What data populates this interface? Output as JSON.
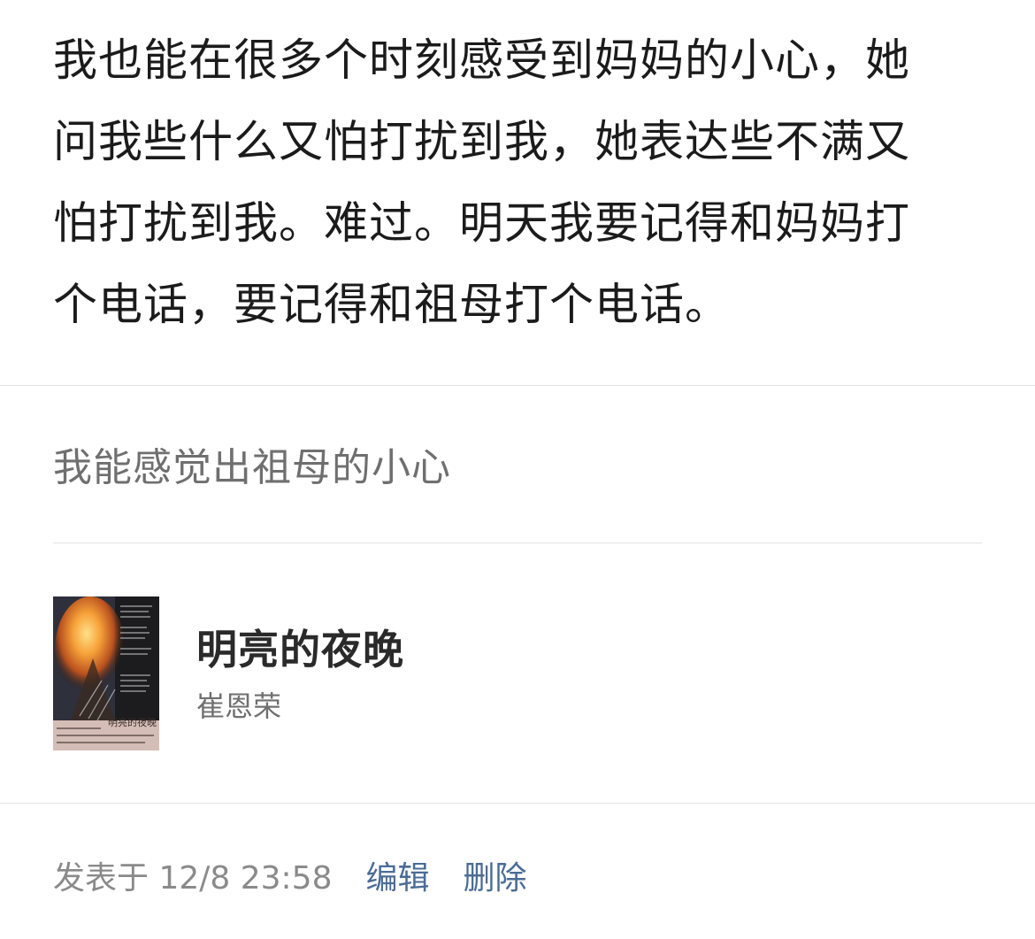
{
  "note": {
    "body": "我也能在很多个时刻感受到妈妈的小心，她\n问我些什么又怕打扰到我，她表达些不满又\n怕打扰到我。难过。明天我要记得和妈妈打\n个电话，要记得和祖母打个电话。"
  },
  "highlight": {
    "text": "我能感觉出祖母的小心"
  },
  "book": {
    "title": "明亮的夜晚",
    "author": "崔恩荣",
    "cover_title": "明亮的夜晚"
  },
  "footer": {
    "timestamp": "发表于 12/8 23:58",
    "edit_label": "编辑",
    "delete_label": "删除"
  },
  "colors": {
    "link": "#4a6c95",
    "secondary_text": "#6f6f6f",
    "divider": "#e3e3e3"
  }
}
